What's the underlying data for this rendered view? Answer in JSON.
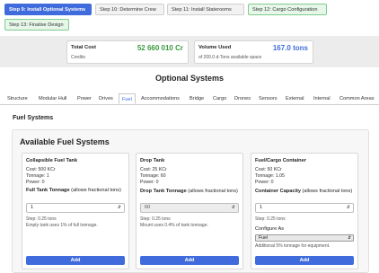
{
  "steps": [
    {
      "label": "Step 9: Install Optional Systems",
      "state": "active"
    },
    {
      "label": "Step 10: Determine Crew",
      "state": "grey"
    },
    {
      "label": "Step 11: Install Staterooms",
      "state": "grey"
    },
    {
      "label": "Step 12: Cargo Configuration",
      "state": "green"
    },
    {
      "label": "Step 13: Finalise Design",
      "state": "green"
    }
  ],
  "summary": {
    "cost": {
      "label": "Total Cost",
      "value": "52 660 010 Cr",
      "sub": "Credits",
      "color": "#3a9a3f"
    },
    "volume": {
      "label": "Volume Used",
      "value": "167.0 tons",
      "sub": "of 200.0 d-Tons available space",
      "color": "#3f6bdc"
    }
  },
  "section_title": "Optional Systems",
  "tabs": [
    "Structure",
    "Modular Hull",
    "Power",
    "Drives",
    "Fuel",
    "Accommodations",
    "Bridge",
    "Cargo",
    "Drones",
    "Sensors",
    "External",
    "Internal",
    "Common Areas"
  ],
  "active_tab": "Fuel",
  "fuel_heading": "Fuel Systems",
  "panel_title": "Available Fuel Systems",
  "items": [
    {
      "name": "Collapsible Fuel Tank",
      "cost": "Cost: 500 KCr",
      "tonnage": "Tonnage: 1",
      "power": "Power: 0",
      "field_label": "Full Tank Tonnage",
      "field_hint": "(allows fractional tons)",
      "value": "1",
      "step": "Step: 0.25 tons",
      "note": "Empty tank uses 1% of full tonnage.",
      "add": "Add"
    },
    {
      "name": "Drop Tank",
      "cost": "Cost: 25 KCr",
      "tonnage": "Tonnage: 60",
      "power": "Power: 0",
      "field_label": "Drop Tank Tonnage",
      "field_hint": "(allows fractional tons)",
      "value": "60",
      "step": "Step: 0.25 tons",
      "note": "Mount uses 0.4% of tank tonnage.",
      "add": "Add"
    },
    {
      "name": "Fuel/Cargo Container",
      "cost": "Cost: 50 KCr",
      "tonnage": "Tonnage: 1.05",
      "power": "Power: 0",
      "field_label": "Container Capacity",
      "field_hint": "(allows fractional tons)",
      "value": "1",
      "step": "Step: 0.25 tons",
      "configure_label": "Configure As",
      "configure_value": "Fuel",
      "note": "Additional 5% tonnage for equipment.",
      "add": "Add"
    }
  ]
}
